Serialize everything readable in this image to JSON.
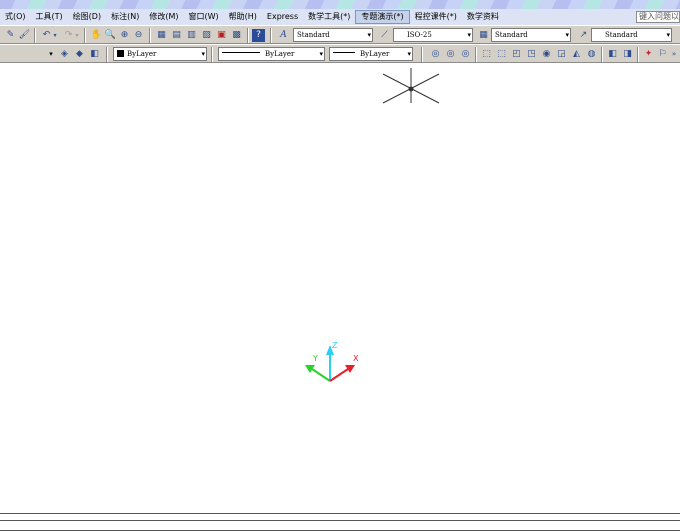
{
  "menu": {
    "items": [
      {
        "label": "式(O)"
      },
      {
        "label": "工具(T)"
      },
      {
        "label": "绘图(D)"
      },
      {
        "label": "标注(N)"
      },
      {
        "label": "修改(M)"
      },
      {
        "label": "窗口(W)"
      },
      {
        "label": "帮助(H)"
      },
      {
        "label": "Express"
      },
      {
        "label": "数学工具(*)"
      },
      {
        "label": "专题演示(*)"
      },
      {
        "label": "程控课件(*)"
      },
      {
        "label": "数学资料"
      }
    ],
    "help_placeholder": "键入问题以"
  },
  "toolbar1": {
    "text_style": "Standard",
    "dim_style": "ISO-25",
    "table_style": "Standard",
    "multileader_style": "Standard"
  },
  "toolbar2": {
    "color": "ByLayer",
    "linetype": "ByLayer",
    "lineweight": "ByLayer"
  },
  "ucs": {
    "x_label": "X",
    "y_label": "Y",
    "z_label": "Z"
  },
  "colors": {
    "x_axis": "#e8202a",
    "y_axis": "#2bd12b",
    "z_axis": "#2ad0f2",
    "menu_bg": "#dbe3f4",
    "toolbar_bg": "#d4d0c8"
  }
}
